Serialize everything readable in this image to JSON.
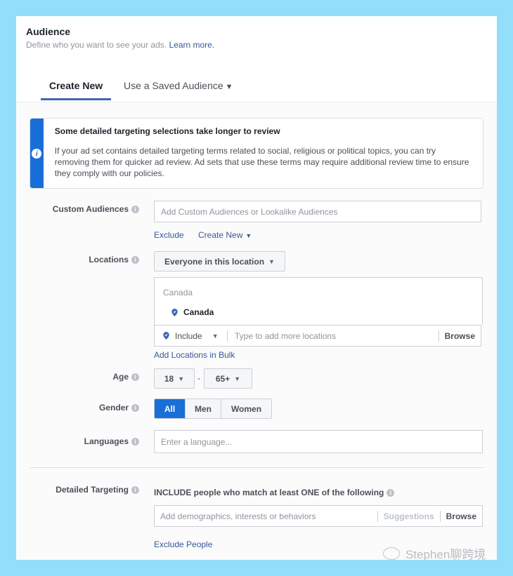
{
  "header": {
    "title": "Audience",
    "subtitle": "Define who you want to see your ads.",
    "learn_more": "Learn more."
  },
  "tabs": [
    {
      "label": "Create New",
      "active": true
    },
    {
      "label": "Use a Saved Audience",
      "active": false,
      "caret": "▼"
    }
  ],
  "notice": {
    "icon": "info-icon",
    "title": "Some detailed targeting selections take longer to review",
    "text": "If your ad set contains detailed targeting terms related to social, religious or political topics, you can try removing them for quicker ad review. Ad sets that use these terms may require additional review time to ensure they comply with our policies."
  },
  "custom_audiences": {
    "label": "Custom Audiences",
    "placeholder": "Add Custom Audiences or Lookalike Audiences",
    "exclude": "Exclude",
    "create_new": "Create New",
    "caret": "▼"
  },
  "locations": {
    "label": "Locations",
    "dropdown": "Everyone in this location",
    "caret": "▼",
    "country_header": "Canada",
    "selected": [
      "Canada"
    ],
    "include": "Include",
    "placeholder": "Type to add more locations",
    "browse": "Browse",
    "bulk": "Add Locations in Bulk"
  },
  "age": {
    "label": "Age",
    "min": "18",
    "separator": "-",
    "max": "65+",
    "caret": "▼"
  },
  "gender": {
    "label": "Gender",
    "options": [
      "All",
      "Men",
      "Women"
    ],
    "selected": "All"
  },
  "languages": {
    "label": "Languages",
    "placeholder": "Enter a language..."
  },
  "detailed_targeting": {
    "label": "Detailed Targeting",
    "heading": "INCLUDE people who match at least ONE of the following",
    "placeholder": "Add demographics, interests or behaviors",
    "suggestions": "Suggestions",
    "browse": "Browse",
    "exclude_people": "Exclude People"
  },
  "watermark": "Stephen聊跨境",
  "colors": {
    "background": "#93dffb",
    "primary": "#1a6ed8",
    "link": "#365899",
    "tab_underline": "#4267b2"
  }
}
